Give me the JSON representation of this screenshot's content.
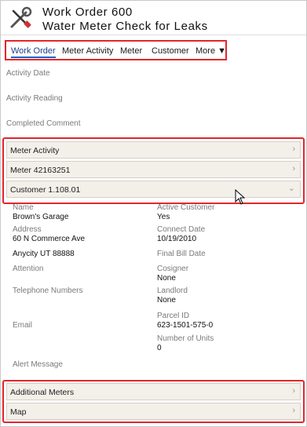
{
  "header": {
    "title_line1": "Work Order 600",
    "title_line2": "Water Meter Check for Leaks",
    "icon": "wrench-screwdriver-icon"
  },
  "tabs": [
    {
      "label": "Work Order",
      "active": true
    },
    {
      "label": "Meter Activity",
      "active": false
    },
    {
      "label": "Meter",
      "active": false
    },
    {
      "label": "Customer",
      "active": false
    },
    {
      "label": "More ▼",
      "active": false
    }
  ],
  "fields": {
    "activity_date": "Activity Date",
    "activity_reading": "Activity Reading",
    "completed_comment": "Completed Comment"
  },
  "sections": {
    "meter_activity": "Meter Activity",
    "meter": "Meter 42163251",
    "customer": "Customer 1.108.01",
    "additional_meters": "Additional Meters",
    "map": "Map"
  },
  "customer": {
    "name_label": "Name",
    "name_value": "Brown's Garage",
    "address_label": "Address",
    "address_line1": "60 N Commerce Ave",
    "address_line2": "Anycity UT 88888",
    "attention_label": "Attention",
    "telephone_label": "Telephone Numbers",
    "email_label": "Email",
    "alert_label": "Alert Message",
    "active_customer_label": "Active Customer",
    "active_customer_value": "Yes",
    "connect_date_label": "Connect Date",
    "connect_date_value": "10/19/2010",
    "final_bill_label": "Final Bill Date",
    "cosigner_label": "Cosigner",
    "cosigner_value": "None",
    "landlord_label": "Landlord",
    "landlord_value": "None",
    "parcel_label": "Parcel ID",
    "parcel_value": "623-1501-575-0",
    "units_label": "Number of Units",
    "units_value": "0"
  },
  "colors": {
    "highlight": "#e3262b",
    "section_bg": "#f3f0ea",
    "active_tab": "#1c5fc4"
  }
}
